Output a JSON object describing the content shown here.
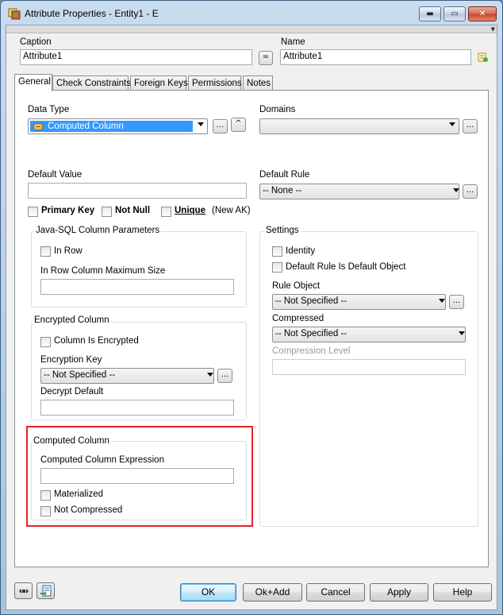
{
  "window": {
    "title": "Attribute Properties - Entity1 - E",
    "minimize_glyph": "▬",
    "maximize_glyph": "▭",
    "close_glyph": "✕"
  },
  "header": {
    "caption_label": "Caption",
    "caption_value": "Attribute1",
    "equals_label": "=",
    "name_label": "Name",
    "name_value": "Attribute1"
  },
  "tabs": [
    {
      "label": "General"
    },
    {
      "label": "Check Constraints"
    },
    {
      "label": "Foreign Keys"
    },
    {
      "label": "Permissions"
    },
    {
      "label": "Notes"
    }
  ],
  "general": {
    "data_type_label": "Data Type",
    "data_type_value": "Computed Column",
    "ellipsis": "...",
    "caret": "^",
    "domains_label": "Domains",
    "domains_value": "",
    "default_value_label": "Default Value",
    "default_value_value": "",
    "default_rule_label": "Default Rule",
    "default_rule_value": "-- None --",
    "primary_key_label": "Primary Key",
    "not_null_label": "Not Null",
    "unique_label": "Unique",
    "new_ak_label": "(New AK)"
  },
  "java_sql": {
    "title": "Java-SQL Column Parameters",
    "in_row_label": "In Row",
    "max_size_label": "In Row Column Maximum Size",
    "max_size_value": ""
  },
  "encrypted": {
    "title": "Encrypted Column",
    "is_encrypted_label": "Column Is Encrypted",
    "key_label": "Encryption Key",
    "key_value": "-- Not Specified --",
    "decrypt_default_label": "Decrypt Default",
    "decrypt_default_value": ""
  },
  "computed": {
    "title": "Computed Column",
    "expression_label": "Computed Column Expression",
    "expression_value": "",
    "materialized_label": "Materialized",
    "not_compressed_label": "Not Compressed",
    "highlight_color": "#e0252a"
  },
  "settings": {
    "title": "Settings",
    "identity_label": "Identity",
    "default_rule_object_label": "Default Rule Is Default Object",
    "rule_object_label": "Rule Object",
    "rule_object_value": "-- Not Specified --",
    "compressed_label": "Compressed",
    "compressed_value": "-- Not Specified --",
    "compression_level_label": "Compression Level",
    "compression_level_value": ""
  },
  "footer": {
    "ok": "OK",
    "ok_add": "Ok+Add",
    "cancel": "Cancel",
    "apply": "Apply",
    "help": "Help",
    "toggle_icon": "toggle-layout-icon",
    "export_icon": "export-icon"
  }
}
